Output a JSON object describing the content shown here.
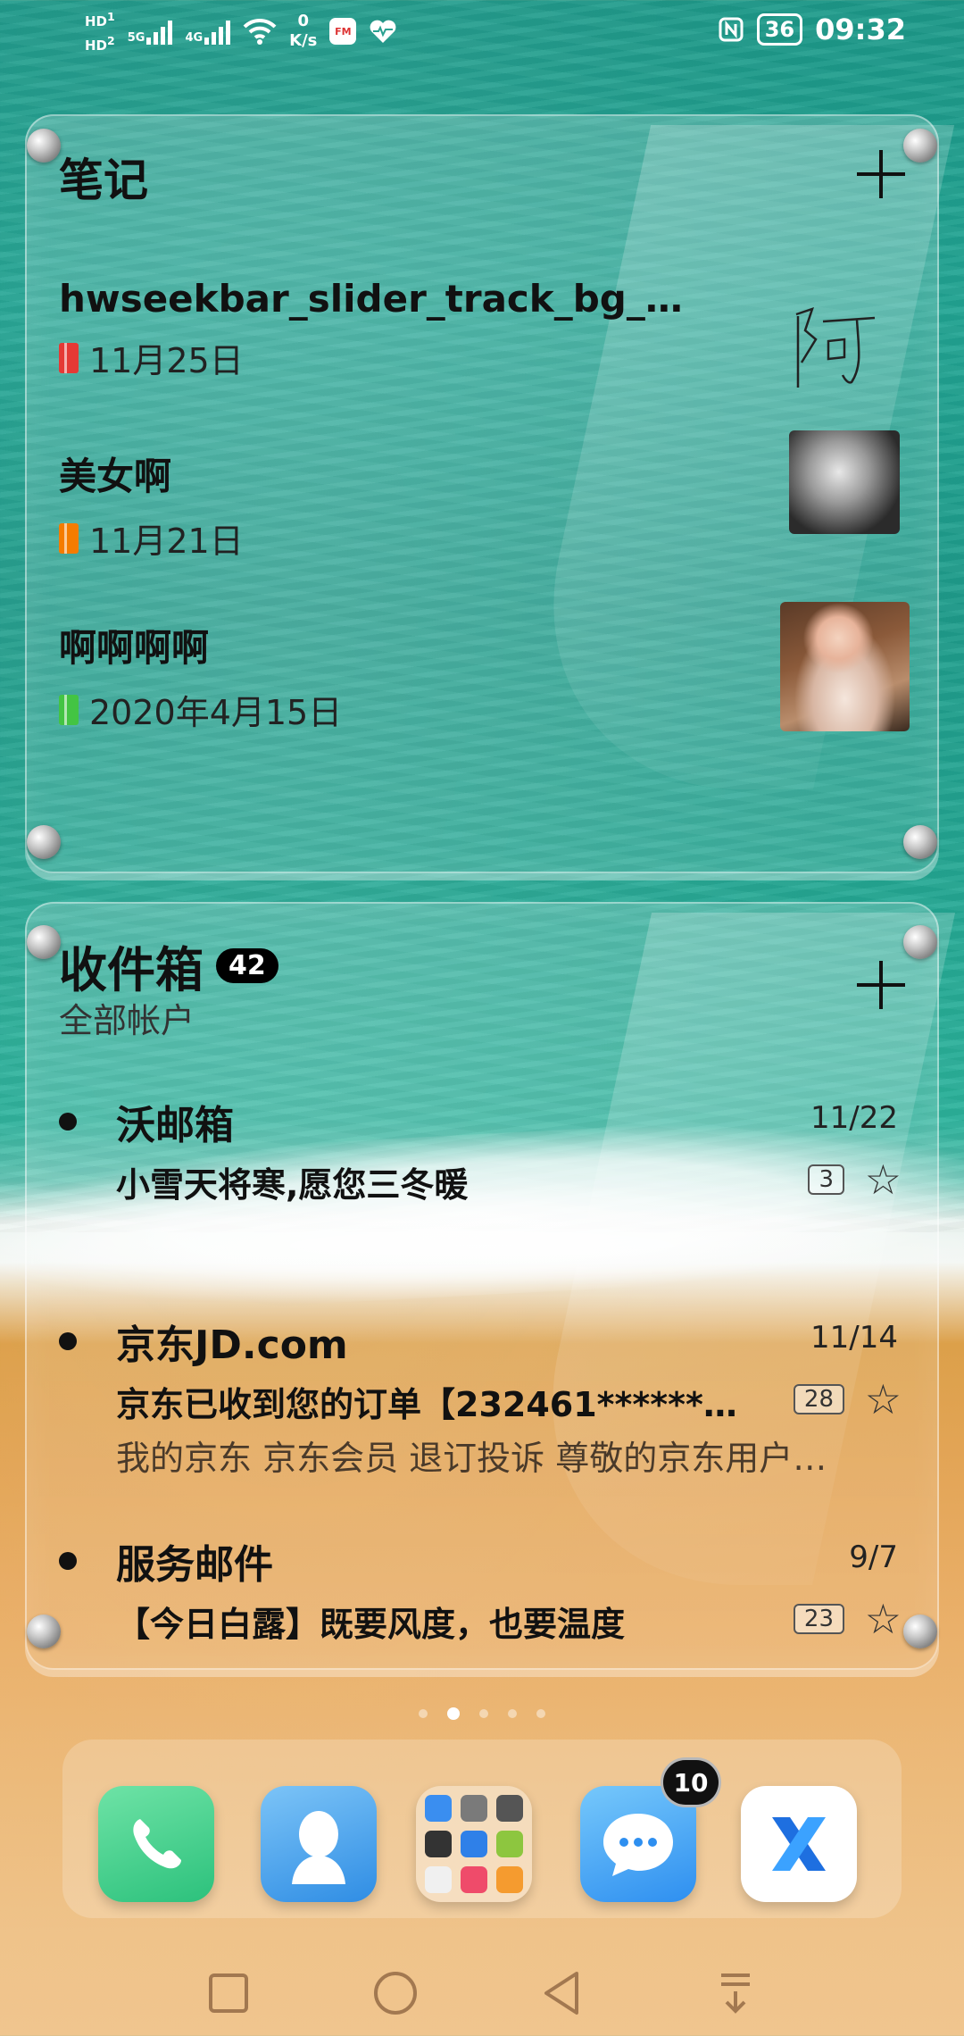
{
  "status_bar": {
    "hd1": "HD",
    "hd1_sub": "1",
    "hd2": "HD",
    "hd2_sub": "2",
    "sig1_label": "5G",
    "sig2_label": "4G",
    "net_speed_value": "0",
    "net_speed_unit": "K/s",
    "fm_label": "FM",
    "nfc_icon": "nfc-icon",
    "battery": "36",
    "time": "09:32"
  },
  "notes_widget": {
    "title": "笔记",
    "add_icon": "plus-icon",
    "items": [
      {
        "title": "hwseekbar_slider_track_bg_e…",
        "date": "11月25日",
        "color": "#e53935",
        "thumb": "handwriting"
      },
      {
        "title": "美女啊",
        "date": "11月21日",
        "color": "#f57c00",
        "thumb": "photo-bw"
      },
      {
        "title": "啊啊啊啊",
        "date": "2020年4月15日",
        "color": "#43c443",
        "thumb": "photo-color"
      }
    ],
    "handwriting_text": "阿"
  },
  "inbox_widget": {
    "title": "收件箱",
    "unread_count": "42",
    "subtitle": "全部帐户",
    "add_icon": "plus-icon",
    "mails": [
      {
        "sender": "沃邮箱",
        "date": "11/22",
        "subject": "小雪天将寒,愿您三冬暖",
        "preview": "",
        "thread_count": "3"
      },
      {
        "sender": "京东JD.com",
        "date": "11/14",
        "subject": "京东已收到您的订单【232461******…",
        "preview": "我的京东 京东会员 退订投诉 尊敬的京东用户…",
        "thread_count": "28"
      },
      {
        "sender": "服务邮件",
        "date": "9/7",
        "subject": "【今日白露】既要风度，也要温度",
        "preview": "",
        "thread_count": "23"
      }
    ]
  },
  "home": {
    "pages": 5,
    "active_page": 2
  },
  "dock": {
    "apps": [
      {
        "name": "phone-app",
        "icon": "phone-icon"
      },
      {
        "name": "contacts-app",
        "icon": "contacts-icon"
      },
      {
        "name": "folder-app",
        "icon": "folder-icon"
      },
      {
        "name": "messages-app",
        "icon": "messages-icon",
        "badge": "10"
      },
      {
        "name": "browser-x-app",
        "icon": "x-browser-icon"
      }
    ]
  },
  "nav_bar": {
    "recent": "recent-apps-icon",
    "home": "home-icon",
    "back": "back-icon",
    "notifications": "notification-pull-icon"
  }
}
